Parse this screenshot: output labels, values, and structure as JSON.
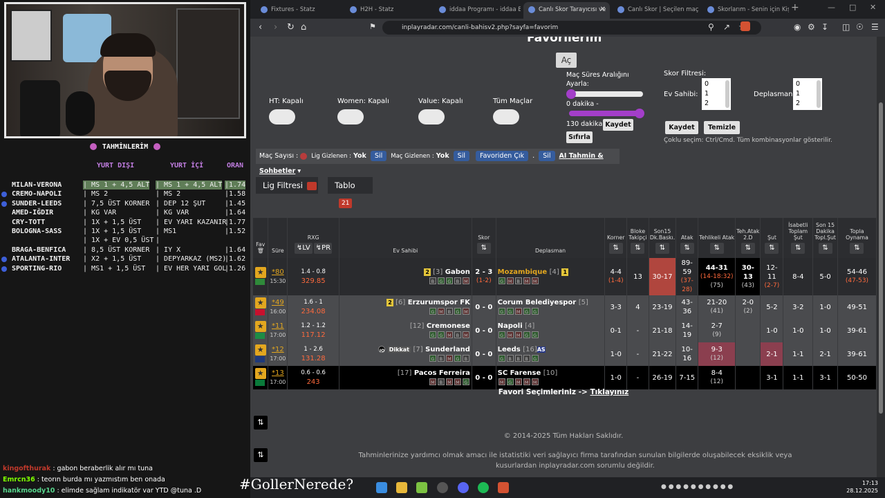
{
  "overlay": {
    "pred_title": "TAHMİNLERİM",
    "col_headers": [
      "YURT DIŞI",
      "YURT İÇİ",
      "ORAN"
    ],
    "predictions": [
      {
        "match": "MILAN-VERONA",
        "yd": "MS 1 + 4,5 ALT",
        "yi": "MS 1 + 4,5 ALT",
        "oran": "|1.74",
        "hl": true,
        "bullet": false
      },
      {
        "match": "CREMO-NAPOLI",
        "yd": "MS 2",
        "yi": "MS 2",
        "oran": "|1.58",
        "hl": false,
        "bullet": true
      },
      {
        "match": "SUNDER-LEEDS",
        "yd": "7,5 ÜST KORNER",
        "yi": "DEP 12 ŞUT",
        "oran": "|1.45",
        "hl": false,
        "bullet": true
      },
      {
        "match": "AMED-IĞDIR",
        "yd": "KG VAR",
        "yi": "KG VAR",
        "oran": "|1.64",
        "hl": false,
        "bullet": false
      },
      {
        "match": "CRY-TOTT",
        "yd": "1X + 1,5 ÜST",
        "yi": "EV YARI KAZANIR",
        "oran": "|1.77",
        "hl": false,
        "bullet": false
      },
      {
        "match": "BOLOGNA-SASS",
        "yd": "1X + 1,5 ÜST",
        "yi": "MS1",
        "oran": "|1.52",
        "hl": false,
        "bullet": false
      },
      {
        "match": "",
        "yd": "1X + EV 0,5 ÜST",
        "yi": "",
        "oran": "",
        "hl": false,
        "bullet": false
      },
      {
        "match": "BRAGA-BENFICA",
        "yd": "8,5 ÜST KORNER",
        "yi": "IY X",
        "oran": "|1.64",
        "hl": false,
        "bullet": false
      },
      {
        "match": "ATALANTA-INTER",
        "yd": "X2 + 1,5 ÜST",
        "yi": "DEPYARKAZ (MS2)",
        "oran": "|1.62",
        "hl": false,
        "bullet": true
      },
      {
        "match": "SPORTING-RIO",
        "yd": "MS1 + 1,5 ÜST",
        "yi": "EV HER YARI GOL",
        "oran": "|1.26",
        "hl": false,
        "bullet": true
      }
    ],
    "chat": [
      {
        "user": "kingofthurak",
        "msg": ": gabon beraberlik alır mı tuna",
        "color": "#c0392b"
      },
      {
        "user": "Emrcn36",
        "msg": ": teorın burda mı yazmıstım ben onada",
        "color": "#7fff00"
      },
      {
        "user": "hankmoody10",
        "msg": ": elimde sağlam indikatör var YTD @tuna .D",
        "color": "#58d68d"
      }
    ],
    "hashtag": "#GollerNerede?"
  },
  "browser": {
    "tabs": [
      {
        "label": "Fixtures - Statz",
        "active": false
      },
      {
        "label": "H2H - Statz",
        "active": false
      },
      {
        "label": "iddaa Programı - iddaa Bü",
        "active": false
      },
      {
        "label": "Canlı Skor Tarayıcısı ve",
        "active": true
      },
      {
        "label": "Canlı Skor | Seçilen maçlar",
        "active": false
      },
      {
        "label": "Skorlarım - Senin için Kişis",
        "active": false
      }
    ],
    "url": "inplayradar.com/canli-bahisv2.php?sayfa=favorim"
  },
  "page": {
    "title": "Favorilerim",
    "open_btn": "Aç",
    "toggles": [
      {
        "label": "HT: Kapalı"
      },
      {
        "label": "Women: Kapalı"
      },
      {
        "label": "Value: Kapalı"
      },
      {
        "label": "Tüm Maçlar"
      }
    ],
    "slider": {
      "title1": "Maç Süres Aralığını",
      "title2": "Ayarla:",
      "min_label": "0 dakika -",
      "max_label": "130 dakika",
      "save": "Kaydet",
      "reset": "Sıfırla"
    },
    "score_filter": {
      "title": "Skor Filtresi:",
      "home_label": "Ev Sahibi:",
      "away_label": "Deplasman:",
      "options": [
        "0",
        "1",
        "2"
      ],
      "save": "Kaydet",
      "clear": "Temizle",
      "hint": "Çoklu seçim: Ctrl/Cmd. Tüm kombinasyonlar gösterilir."
    },
    "infobar": {
      "mac_sayisi": "Maç Sayısı :",
      "lig_gizlenen": "Lig Gizlenen :",
      "yok1": "Yok",
      "sil1": "Sil",
      "mac_gizlenen": "Maç Gizlenen :",
      "yok2": "Yok",
      "sil2": "Sil",
      "fav_cik": "Favoriden Çık",
      "dot": ".",
      "sil3": "Sil",
      "ai": "AI Tahmin & Sohbetler"
    },
    "lig_filtresi": "Lig Filtresi",
    "tablo": "Tablo",
    "tablo_count": "21",
    "headers": {
      "fav": "Fav",
      "sure": "Süre",
      "rxg": "RXG",
      "lv": "LV",
      "pr": "PR",
      "ev": "Ev Sahibi",
      "skor": "Skor",
      "dep": "Deplasman",
      "korner": "Korner",
      "bloke": "Bloke Takipçi",
      "son15": "Son15 Dk.Baskı.",
      "atak": "Atak",
      "tehlikeli": "Tehlikeli Atak",
      "teh2d": "Teh.Atak 2.D",
      "sut": "Şut",
      "isabetli": "İsabetli Toplam Şut",
      "son15sut": "Son 15 Dakika Topl.Şut",
      "topla": "Topla Oynama"
    },
    "matches": [
      {
        "min": "*80",
        "time": "15:30",
        "rxg": "1.4 - 0.8",
        "rxg2": "329.85",
        "home": "Gabon",
        "home_rank": "[3]",
        "home_card": "2",
        "score": "2 - 3",
        "ht": "(1-2)",
        "away": "Mozambique",
        "away_rank": "[4]",
        "away_card": "1",
        "home_form": [
          "B",
          "G",
          "G",
          "B",
          "M"
        ],
        "away_form": [
          "G",
          "M",
          "B",
          "M",
          "M"
        ],
        "korner": "4-4",
        "korner2": "(1-4)",
        "bloke": "13",
        "son15": "30-17",
        "atak": "89-59",
        "atak2": "(37-28)",
        "teh": "44-31",
        "teh2": "(14-18:32)",
        "teh3": "(75)",
        "teh2d": "30-13",
        "teh2d2": "(43)",
        "sut": "12-11",
        "sut2": "(2-7)",
        "isabetli": "8-4",
        "son15sut": "5-0",
        "topla": "54-46",
        "topla2": "(47-53)"
      },
      {
        "min": "*49",
        "time": "16:00",
        "rxg": "1.6 - 1",
        "rxg2": "234.08",
        "home": "Erzurumspor FK",
        "home_rank": "[6]",
        "home_card": "2",
        "score": "0 - 0",
        "ht": "",
        "away": "Corum Belediyespor",
        "away_rank": "[5]",
        "away_card": "",
        "home_form": [
          "G",
          "M",
          "B",
          "G",
          "M"
        ],
        "away_form": [
          "G",
          "G",
          "M",
          "G",
          "G"
        ],
        "korner": "3-3",
        "korner2": "",
        "bloke": "4",
        "son15": "23-19",
        "atak": "43-36",
        "atak2": "",
        "teh": "21-20",
        "teh2": "(41)",
        "teh3": "",
        "teh2d": "2-0",
        "teh2d2": "(2)",
        "sut": "5-2",
        "sut2": "",
        "isabetli": "3-2",
        "son15sut": "1-0",
        "topla": "49-51",
        "topla2": ""
      },
      {
        "min": "*11",
        "time": "17:00",
        "rxg": "1.2 - 1.2",
        "rxg2": "117.12",
        "home": "Cremonese",
        "home_rank": "[12]",
        "home_card": "",
        "score": "0 - 0",
        "ht": "",
        "away": "Napoli",
        "away_rank": "[4]",
        "away_card": "",
        "home_form": [
          "G",
          "G",
          "M",
          "B",
          "M"
        ],
        "away_form": [
          "G",
          "M",
          "M",
          "G",
          "G"
        ],
        "korner": "0-1",
        "korner2": "",
        "bloke": "-",
        "son15": "21-18",
        "atak": "14-19",
        "atak2": "",
        "teh": "2-7",
        "teh2": "(9)",
        "teh3": "",
        "teh2d": "",
        "teh2d2": "",
        "sut": "1-0",
        "sut2": "",
        "isabetli": "1-0",
        "son15sut": "1-0",
        "topla": "39-61",
        "topla2": ""
      },
      {
        "min": "*12",
        "time": "17:00",
        "rxg": "1 - 2.6",
        "rxg2": "131.28",
        "home": "Sunderland",
        "home_rank": "[7]",
        "home_card": "",
        "dikkat": "Dikkat",
        "score": "0 - 0",
        "ht": "",
        "away": "Leeds",
        "away_rank": "[16]",
        "away_card": "",
        "away_extra": "AS",
        "home_form": [
          "G",
          "B",
          "M",
          "G",
          "B"
        ],
        "away_form": [
          "G",
          "B",
          "B",
          "B",
          "G"
        ],
        "korner": "1-0",
        "korner2": "",
        "bloke": "-",
        "son15": "21-22",
        "atak": "10-16",
        "atak2": "",
        "teh": "9-3",
        "teh2": "(12)",
        "teh3": "",
        "teh2d": "",
        "teh2d2": "",
        "sut": "2-1",
        "sut2": "",
        "isabetli": "1-1",
        "son15sut": "2-1",
        "topla": "39-61",
        "topla2": ""
      },
      {
        "min": "*13",
        "time": "17:00",
        "rxg": "0.6 - 0.6",
        "rxg2": "243",
        "home": "Pacos Ferreira",
        "home_rank": "[17]",
        "home_card": "",
        "score": "0 - 0",
        "ht": "",
        "away": "SC Farense",
        "away_rank": "[10]",
        "away_card": "",
        "home_form": [
          "M",
          "B",
          "M",
          "M",
          "G"
        ],
        "away_form": [
          "M",
          "G",
          "M",
          "M",
          "M"
        ],
        "korner": "1-0",
        "korner2": "",
        "bloke": "-",
        "son15": "26-19",
        "atak": "7-15",
        "atak2": "",
        "teh": "8-4",
        "teh2": "(12)",
        "teh3": "",
        "teh2d": "",
        "teh2d2": "",
        "sut": "3-1",
        "sut2": "",
        "isabetli": "1-1",
        "son15sut": "3-1",
        "topla": "50-50",
        "topla2": ""
      }
    ],
    "fav_foot_text": "Favori Seçimleriniz ->",
    "fav_foot_link": "Tıklayınız",
    "copyright": "© 2014-2025 Tüm Hakları Saklıdır.",
    "disclaimer": "Tahminlerinize yardımcı olmak amacı ile istatistiki veri sağlayıcı firma tarafından sunulan bilgilerde oluşabilecek eksiklik veya kusurlardan inplayradar.com sorumlu değildir."
  },
  "taskbar": {
    "time": "17:13",
    "date": "28.12.2025"
  }
}
